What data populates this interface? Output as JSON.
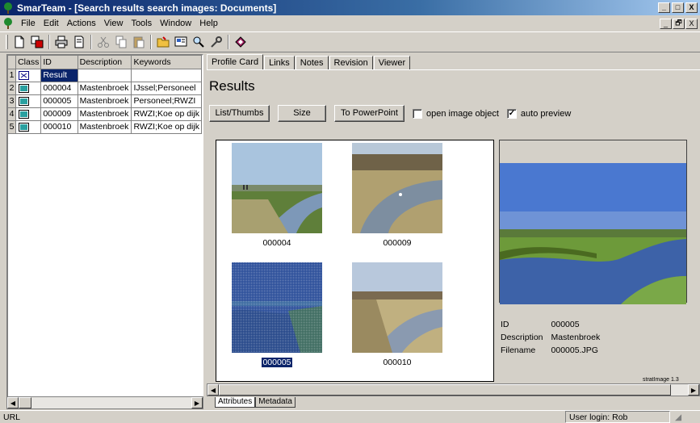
{
  "window": {
    "title": "SmarTeam - [Search results search images: Documents]",
    "controls": [
      "_",
      "□",
      "X"
    ],
    "mdi_controls": [
      "_",
      "🗗",
      "X"
    ]
  },
  "menu": [
    "File",
    "Edit",
    "Actions",
    "View",
    "Tools",
    "Window",
    "Help"
  ],
  "toolbar": {
    "icons": [
      "new-icon",
      "copy-object-icon",
      "print-icon",
      "print-preview-icon",
      "cut-icon",
      "copy-icon",
      "paste-icon",
      "open-folder-icon",
      "view-icon",
      "search-icon",
      "tools-icon",
      "book-icon"
    ]
  },
  "grid": {
    "columns": [
      "Class",
      "ID",
      "Description",
      "Keywords"
    ],
    "rows": [
      {
        "num": "1",
        "id": "Result",
        "description": "",
        "keywords": ""
      },
      {
        "num": "2",
        "id": "000004",
        "description": "Mastenbroek",
        "keywords": "IJssel;Personeel"
      },
      {
        "num": "3",
        "id": "000005",
        "description": "Mastenbroek",
        "keywords": "Personeel;RWZI"
      },
      {
        "num": "4",
        "id": "000009",
        "description": "Mastenbroek",
        "keywords": "RWZI;Koe op dijk"
      },
      {
        "num": "5",
        "id": "000010",
        "description": "Mastenbroek",
        "keywords": "RWZI;Koe op dijk"
      }
    ]
  },
  "tabs": [
    "Profile Card",
    "Links",
    "Notes",
    "Revision",
    "Viewer"
  ],
  "active_tab": "Profile Card",
  "results": {
    "title": "Results",
    "buttons": {
      "list_thumbs": "List/Thumbs",
      "size": "Size",
      "to_powerpoint": "To PowerPoint"
    },
    "checkboxes": {
      "open_image_object": {
        "label": "open image object",
        "checked": false
      },
      "auto_preview": {
        "label": "auto preview",
        "checked": true
      }
    },
    "thumbnails": [
      {
        "caption": "000004",
        "selected": false
      },
      {
        "caption": "000009",
        "selected": false
      },
      {
        "caption": "000005",
        "selected": true
      },
      {
        "caption": "000010",
        "selected": false
      }
    ]
  },
  "preview": {
    "meta": [
      {
        "label": "ID",
        "value": "000005"
      },
      {
        "label": "Description",
        "value": "Mastenbroek"
      },
      {
        "label": "Filename",
        "value": "000005.JPG"
      }
    ],
    "stamp": "stratImage 1.3"
  },
  "bottom_tabs": [
    "Attributes",
    "Metadata"
  ],
  "status": {
    "left": "URL",
    "user": "User login: Rob"
  }
}
